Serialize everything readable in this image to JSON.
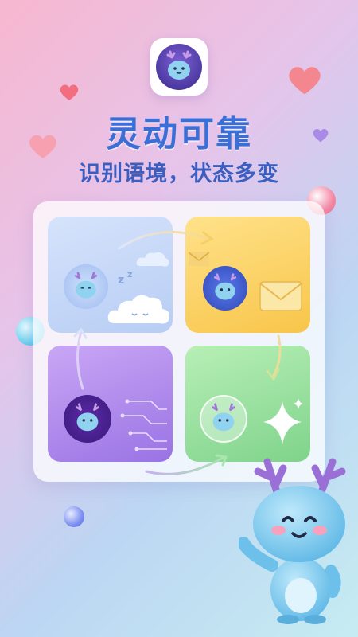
{
  "hero": {
    "title": "灵动可靠",
    "subtitle": "识别语境，状态多变"
  },
  "icons": {
    "app": "dragon-mascot-icon",
    "sleep": "sleep-zz-icon",
    "cloud": "sleeping-cloud-icon",
    "mail": "envelope-icon",
    "circuit": "circuit-icon",
    "sparkle": "sparkle-icon"
  },
  "colors": {
    "title": "#3b6fd8",
    "subtitle": "#3b5fc0",
    "tile_sleep": "#c6d8f8",
    "tile_mail": "#fbd466",
    "tile_chip": "#b08cee",
    "tile_spark": "#a3e2a6",
    "mascot_body": "#8fd3f0",
    "mascot_antler": "#7a4fc6"
  }
}
